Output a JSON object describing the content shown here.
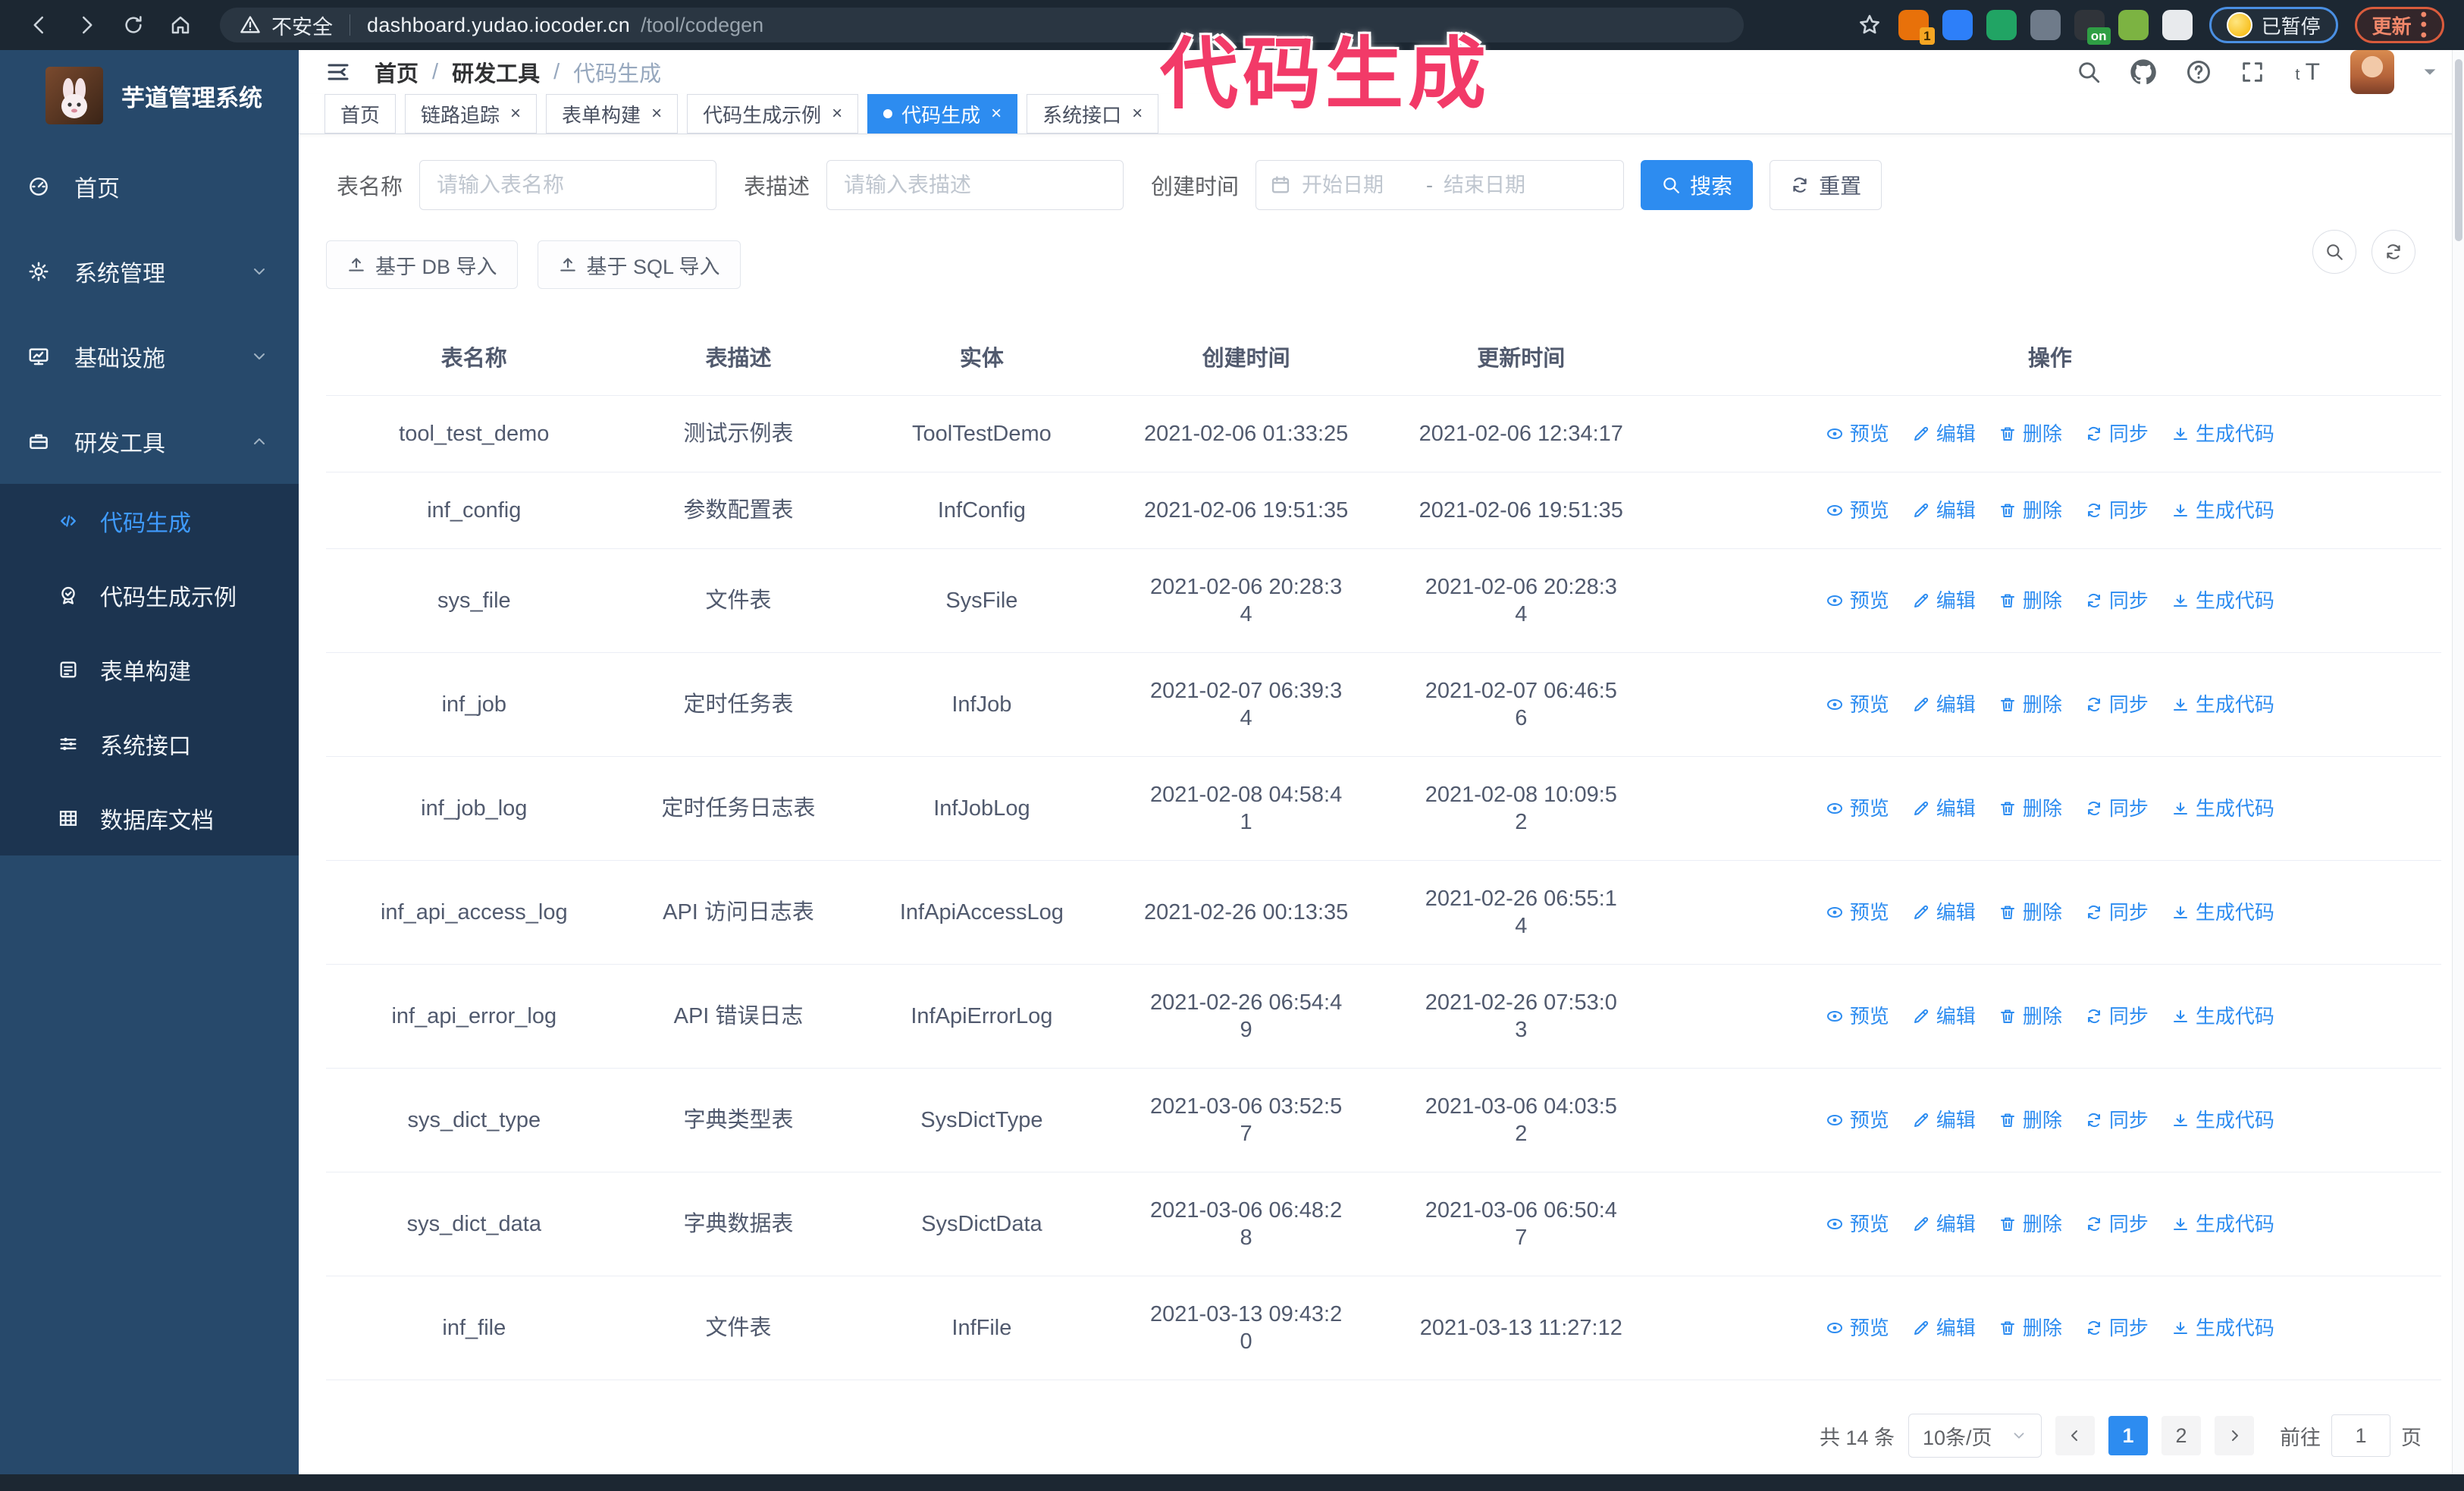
{
  "annotation": {
    "text": "代码生成",
    "color": "#f23a68"
  },
  "browser": {
    "nav_icons": [
      "arrow-left",
      "arrow-right",
      "reload",
      "home"
    ],
    "security_label": "不安全",
    "url_host": "dashboard.yudao.iocoder.cn",
    "url_path": "/tool/codegen",
    "star_icon": "star",
    "extensions": [
      {
        "name": "ext-orange-c",
        "color": "#e8710a",
        "badge": "1"
      },
      {
        "name": "ext-blue-gem",
        "color": "#2d7ff9",
        "badge": ""
      },
      {
        "name": "ext-green-check",
        "color": "#21a464",
        "badge": ""
      },
      {
        "name": "ext-gray-grid",
        "color": "#6f7b8a",
        "badge": ""
      },
      {
        "name": "ext-dark-on",
        "color": "#30343a",
        "badge": "on"
      },
      {
        "name": "ext-green-robot",
        "color": "#7cb342",
        "badge": ""
      },
      {
        "name": "ext-puzzle",
        "color": "#e8eaed",
        "badge": ""
      }
    ],
    "paused_badge": "已暂停",
    "update_button": "更新"
  },
  "sidebar": {
    "app_title": "芋道管理系统",
    "items": [
      {
        "icon": "dashboard",
        "label": "首页",
        "chevron": "",
        "active": false
      },
      {
        "icon": "gear",
        "label": "系统管理",
        "chevron": "down",
        "active": false
      },
      {
        "icon": "monitor",
        "label": "基础设施",
        "chevron": "down",
        "active": false
      },
      {
        "icon": "briefcase",
        "label": "研发工具",
        "chevron": "up",
        "active": false
      }
    ],
    "submenu": [
      {
        "icon": "code",
        "label": "代码生成",
        "active": true
      },
      {
        "icon": "seal",
        "label": "代码生成示例",
        "active": false
      },
      {
        "icon": "form",
        "label": "表单构建",
        "active": false
      },
      {
        "icon": "sliders",
        "label": "系统接口",
        "active": false
      },
      {
        "icon": "dbgrid",
        "label": "数据库文档",
        "active": false
      }
    ]
  },
  "header": {
    "breadcrumb": [
      "首页",
      "研发工具",
      "代码生成"
    ],
    "separator": "/",
    "right_icons": [
      "search",
      "github",
      "help",
      "fullscreen",
      "textsize"
    ]
  },
  "tabs": [
    {
      "label": "首页",
      "closable": false,
      "active": false
    },
    {
      "label": "链路追踪",
      "closable": true,
      "active": false
    },
    {
      "label": "表单构建",
      "closable": true,
      "active": false
    },
    {
      "label": "代码生成示例",
      "closable": true,
      "active": false
    },
    {
      "label": "代码生成",
      "closable": true,
      "active": true
    },
    {
      "label": "系统接口",
      "closable": true,
      "active": false
    }
  ],
  "filters": {
    "table_name_label": "表名称",
    "table_name_placeholder": "请输入表名称",
    "table_desc_label": "表描述",
    "table_desc_placeholder": "请输入表描述",
    "create_time_label": "创建时间",
    "start_placeholder": "开始日期",
    "range_separator": "-",
    "end_placeholder": "结束日期",
    "search_label": "搜索",
    "reset_label": "重置"
  },
  "toolbar": {
    "db_import": "基于 DB 导入",
    "sql_import": "基于 SQL 导入"
  },
  "table": {
    "columns": [
      "表名称",
      "表描述",
      "实体",
      "创建时间",
      "更新时间",
      "操作"
    ],
    "actions": [
      {
        "name": "preview",
        "icon": "eye",
        "label": "预览"
      },
      {
        "name": "edit",
        "icon": "edit",
        "label": "编辑"
      },
      {
        "name": "delete",
        "icon": "trash",
        "label": "删除"
      },
      {
        "name": "sync",
        "icon": "sync",
        "label": "同步"
      },
      {
        "name": "generate-code",
        "icon": "download",
        "label": "生成代码"
      }
    ],
    "rows": [
      {
        "name": "tool_test_demo",
        "desc": "测试示例表",
        "entity": "ToolTestDemo",
        "created": "2021-02-06 01:33:25",
        "created_wrap": false,
        "updated": "2021-02-06 12:34:17",
        "updated_wrap": false
      },
      {
        "name": "inf_config",
        "desc": "参数配置表",
        "entity": "InfConfig",
        "created": "2021-02-06 19:51:35",
        "created_wrap": false,
        "updated": "2021-02-06 19:51:35",
        "updated_wrap": false
      },
      {
        "name": "sys_file",
        "desc": "文件表",
        "entity": "SysFile",
        "created": "2021-02-06 20:28:34",
        "created_wrap": true,
        "updated": "2021-02-06 20:28:34",
        "updated_wrap": true
      },
      {
        "name": "inf_job",
        "desc": "定时任务表",
        "entity": "InfJob",
        "created": "2021-02-07 06:39:34",
        "created_wrap": true,
        "updated": "2021-02-07 06:46:56",
        "updated_wrap": true
      },
      {
        "name": "inf_job_log",
        "desc": "定时任务日志表",
        "entity": "InfJobLog",
        "created": "2021-02-08 04:58:41",
        "created_wrap": true,
        "updated": "2021-02-08 10:09:52",
        "updated_wrap": true
      },
      {
        "name": "inf_api_access_log",
        "desc": "API 访问日志表",
        "entity": "InfApiAccessLog",
        "created": "2021-02-26 00:13:35",
        "created_wrap": false,
        "updated": "2021-02-26 06:55:14",
        "updated_wrap": true
      },
      {
        "name": "inf_api_error_log",
        "desc": "API 错误日志",
        "entity": "InfApiErrorLog",
        "created": "2021-02-26 06:54:49",
        "created_wrap": true,
        "updated": "2021-02-26 07:53:03",
        "updated_wrap": true
      },
      {
        "name": "sys_dict_type",
        "desc": "字典类型表",
        "entity": "SysDictType",
        "created": "2021-03-06 03:52:57",
        "created_wrap": true,
        "updated": "2021-03-06 04:03:52",
        "updated_wrap": true
      },
      {
        "name": "sys_dict_data",
        "desc": "字典数据表",
        "entity": "SysDictData",
        "created": "2021-03-06 06:48:28",
        "created_wrap": true,
        "updated": "2021-03-06 06:50:47",
        "updated_wrap": true
      },
      {
        "name": "inf_file",
        "desc": "文件表",
        "entity": "InfFile",
        "created": "2021-03-13 09:43:20",
        "created_wrap": true,
        "updated": "2021-03-13 11:27:12",
        "updated_wrap": false
      }
    ]
  },
  "pagination": {
    "total": "共 14 条",
    "page_size": "10条/页",
    "pages": [
      "1",
      "2"
    ],
    "active_page": "1",
    "goto_label": "前往",
    "goto_value": "1",
    "goto_suffix": "页"
  }
}
